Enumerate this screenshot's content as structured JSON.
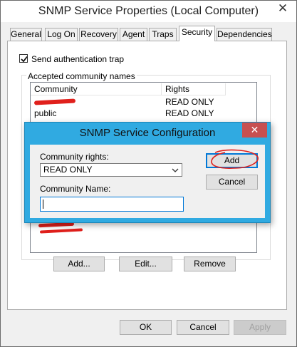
{
  "window": {
    "title": "SNMP Service Properties (Local Computer)",
    "close_glyph": "✕"
  },
  "tabs": [
    {
      "label": "General"
    },
    {
      "label": "Log On"
    },
    {
      "label": "Recovery"
    },
    {
      "label": "Agent"
    },
    {
      "label": "Traps"
    },
    {
      "label": "Security"
    },
    {
      "label": "Dependencies"
    }
  ],
  "security": {
    "send_auth_trap_label": "Send authentication trap",
    "send_auth_trap_checked": true,
    "community_group_label": "Accepted community names",
    "columns": {
      "community": "Community",
      "rights": "Rights"
    },
    "rows": [
      {
        "community": "",
        "rights": "READ ONLY",
        "redacted": true
      },
      {
        "community": "public",
        "rights": "READ ONLY",
        "redacted": false
      }
    ],
    "buttons": {
      "add": "Add...",
      "edit": "Edit...",
      "remove": "Remove"
    }
  },
  "footer": {
    "ok": "OK",
    "cancel": "Cancel",
    "apply": "Apply"
  },
  "dialog": {
    "title": "SNMP Service Configuration",
    "close_glyph": "✕",
    "rights_label": "Community rights:",
    "rights_value": "READ ONLY",
    "name_label": "Community Name:",
    "name_value": "",
    "add_label": "Add",
    "cancel_label": "Cancel"
  },
  "colors": {
    "dialog_frame": "#30aae1",
    "dialog_close": "#c75050",
    "annotation_red": "#e0201c"
  },
  "icons": {
    "checkbox": "checkmark-icon",
    "select": "chevron-down-icon"
  }
}
